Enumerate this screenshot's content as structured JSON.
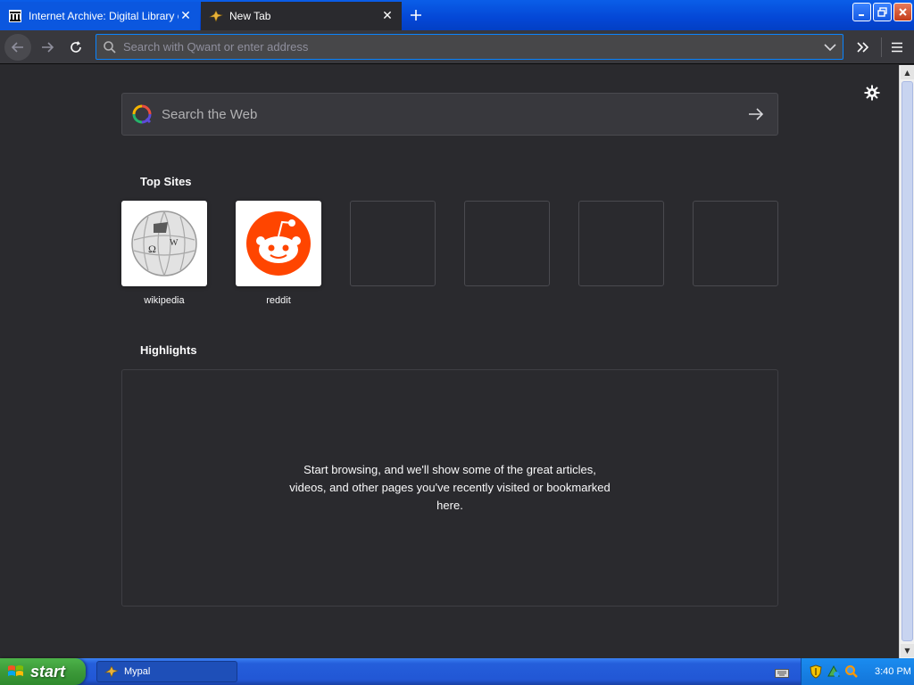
{
  "tabs": [
    {
      "title": "Internet Archive: Digital Library of",
      "active": false
    },
    {
      "title": "New Tab",
      "active": true
    }
  ],
  "urlbar": {
    "placeholder": "Search with Qwant or enter address"
  },
  "websearch": {
    "placeholder": "Search the Web"
  },
  "top_sites": {
    "title": "Top Sites",
    "items": [
      {
        "label": "wikipedia",
        "icon": "wikipedia-globe-icon"
      },
      {
        "label": "reddit",
        "icon": "reddit-icon"
      }
    ]
  },
  "highlights": {
    "title": "Highlights",
    "message": "Start browsing, and we'll show some of the great articles, videos, and other pages you've recently visited or bookmarked here."
  },
  "taskbar": {
    "start_label": "start",
    "task_label": "Mypal",
    "clock": "3:40 PM"
  },
  "colors": {
    "accent": "#0a84ff",
    "reddit": "#ff4500",
    "content_bg": "#2a2a2e"
  }
}
